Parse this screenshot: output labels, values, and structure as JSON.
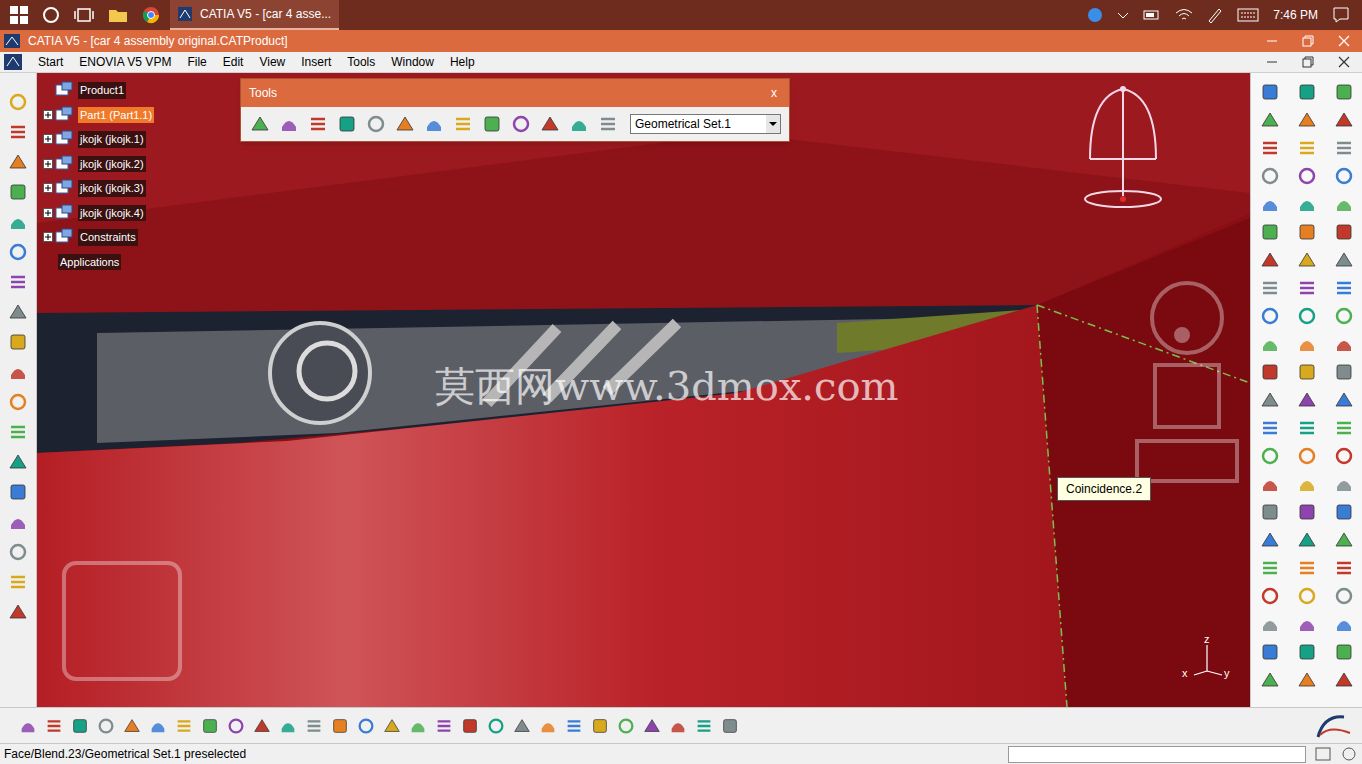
{
  "taskbar": {
    "active_app": "CATIA V5 - [car 4 asse...",
    "time": "7:46 PM"
  },
  "window": {
    "title": "CATIA V5 - [car 4 assembly original.CATProduct]"
  },
  "menu": [
    {
      "label": "Start"
    },
    {
      "label": "ENOVIA V5 VPM"
    },
    {
      "label": "File"
    },
    {
      "label": "Edit"
    },
    {
      "label": "View"
    },
    {
      "label": "Insert"
    },
    {
      "label": "Tools"
    },
    {
      "label": "Window"
    },
    {
      "label": "Help"
    }
  ],
  "tree": [
    {
      "label": "Product1",
      "selected": false,
      "expandable": false
    },
    {
      "label": "Part1 (Part1.1)",
      "selected": true,
      "expandable": true
    },
    {
      "label": "jkojk (jkojk.1)",
      "selected": false,
      "expandable": true
    },
    {
      "label": "jkojk (jkojk.2)",
      "selected": false,
      "expandable": true
    },
    {
      "label": "jkojk (jkojk.3)",
      "selected": false,
      "expandable": true
    },
    {
      "label": "jkojk (jkojk.4)",
      "selected": false,
      "expandable": true
    },
    {
      "label": "Constraints",
      "selected": false,
      "expandable": true
    },
    {
      "label": "Applications",
      "selected": false,
      "expandable": false
    }
  ],
  "tools_toolbar": {
    "title": "Tools",
    "close": "x",
    "dropdown": "Geometrical Set.1"
  },
  "viewport": {
    "watermark": "莫西网www.3dmox.com",
    "tooltip": "Coincidence.2",
    "axis": [
      "z",
      "x",
      "y"
    ]
  },
  "status_bar": {
    "text": "Face/Blend.23/Geometrical Set.1 preselected"
  }
}
